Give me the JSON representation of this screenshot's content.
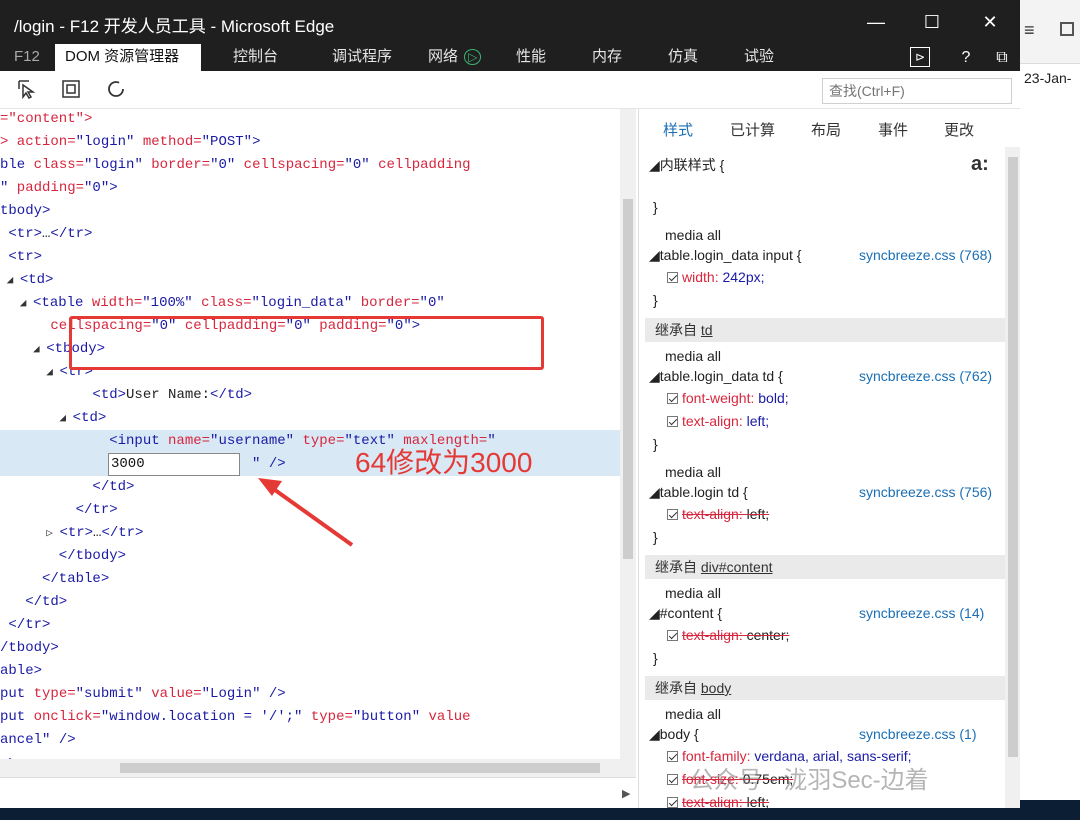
{
  "background": {
    "date_fragment": "23-Jan-"
  },
  "window": {
    "title": "/login - F12 开发人员工具 - Microsoft Edge",
    "minimize": "—",
    "maximize": "☐",
    "close": "✕"
  },
  "tabs": {
    "f12": "F12",
    "items": [
      "DOM 资源管理器",
      "控制台",
      "调试程序",
      "网络",
      "性能",
      "内存",
      "仿真",
      "试验"
    ],
    "network_icon": "▷",
    "tools": [
      "⊳",
      "?",
      "⧉"
    ]
  },
  "toolbar": {
    "find_placeholder": "查找(Ctrl+F)"
  },
  "dom": {
    "lines": [
      {
        "seg": [
          [
            "an",
            "=\"content\">"
          ]
        ]
      },
      {
        "seg": [
          [
            "an",
            "> action="
          ],
          [
            "av",
            "\"login\""
          ],
          [
            "an",
            " method="
          ],
          [
            "av",
            "\"POST\""
          ],
          [
            "tg",
            ">"
          ]
        ]
      },
      {
        "seg": [
          [
            "tg",
            "ble "
          ],
          [
            "an",
            "class="
          ],
          [
            "av",
            "\"login\""
          ],
          [
            "an",
            " border="
          ],
          [
            "av",
            "\"0\""
          ],
          [
            "an",
            " cellspacing="
          ],
          [
            "av",
            "\"0\""
          ],
          [
            "an",
            " cellpadding"
          ]
        ]
      },
      {
        "seg": [
          [
            "av",
            "\""
          ],
          [
            "an",
            " padding="
          ],
          [
            "av",
            "\"0\""
          ],
          [
            "tg",
            ">"
          ]
        ]
      },
      {
        "seg": [
          [
            "tg",
            "tbody>"
          ]
        ]
      },
      {
        "seg": [
          [
            "tg",
            " <tr>"
          ],
          [
            "tx",
            "…"
          ],
          [
            "tg",
            "</tr>"
          ]
        ]
      },
      {
        "seg": [
          [
            "tg",
            " <tr>"
          ]
        ]
      },
      {
        "seg": [
          [
            "arr",
            " ◢ "
          ],
          [
            "tg",
            "<td>"
          ]
        ]
      },
      {
        "seg": [
          [
            "arr",
            "   ◢ "
          ],
          [
            "tg",
            "<table "
          ],
          [
            "an",
            "width="
          ],
          [
            "av",
            "\"100%\""
          ],
          [
            "an",
            " class="
          ],
          [
            "av",
            "\"login_data\""
          ],
          [
            "an",
            " border="
          ],
          [
            "av",
            "\"0\""
          ]
        ]
      },
      {
        "seg": [
          [
            "an",
            "      cellspacing="
          ],
          [
            "av",
            "\"0\""
          ],
          [
            "an",
            " cellpadding="
          ],
          [
            "av",
            "\"0\""
          ],
          [
            "an",
            " padding="
          ],
          [
            "av",
            "\"0\""
          ],
          [
            "tg",
            ">"
          ]
        ]
      },
      {
        "seg": [
          [
            "arr",
            "     ◢ "
          ],
          [
            "tg",
            "<tbody>"
          ]
        ]
      },
      {
        "seg": [
          [
            "arr",
            "       ◢ "
          ],
          [
            "tg",
            "<tr>"
          ]
        ]
      },
      {
        "seg": [
          [
            "tg",
            "           <td>"
          ],
          [
            "tx",
            "User Name:"
          ],
          [
            "tg",
            "</td>"
          ]
        ]
      },
      {
        "seg": [
          [
            "arr",
            "         ◢ "
          ],
          [
            "tg",
            "<td>"
          ]
        ]
      },
      {
        "seg": [
          [
            "tg",
            "             <input "
          ],
          [
            "an",
            "name="
          ],
          [
            "av",
            "\"username\""
          ],
          [
            "an",
            " type="
          ],
          [
            "av",
            "\"text\""
          ],
          [
            "an",
            " maxlength="
          ],
          [
            "av",
            "\""
          ]
        ],
        "sel": true
      },
      {
        "seg": [
          [
            "av",
            "                              \""
          ],
          [
            "tg",
            " />"
          ]
        ],
        "sel": true
      },
      {
        "seg": [
          [
            "tg",
            "           </td>"
          ]
        ]
      },
      {
        "seg": [
          [
            "tg",
            "         </tr>"
          ]
        ]
      },
      {
        "seg": [
          [
            "arr",
            "       ▷ "
          ],
          [
            "tg",
            "<tr>"
          ],
          [
            "tx",
            "…"
          ],
          [
            "tg",
            "</tr>"
          ]
        ]
      },
      {
        "seg": [
          [
            "tg",
            "       </tbody>"
          ]
        ]
      },
      {
        "seg": [
          [
            "tg",
            "     </table>"
          ]
        ]
      },
      {
        "seg": [
          [
            "tg",
            "   </td>"
          ]
        ]
      },
      {
        "seg": [
          [
            "tg",
            " </tr>"
          ]
        ]
      },
      {
        "seg": [
          [
            "tg",
            "/tbody>"
          ]
        ]
      },
      {
        "seg": [
          [
            "tg",
            "able>"
          ]
        ]
      },
      {
        "seg": [
          [
            "tg",
            "put "
          ],
          [
            "an",
            "type="
          ],
          [
            "av",
            "\"submit\""
          ],
          [
            "an",
            " value="
          ],
          [
            "av",
            "\"Login\""
          ],
          [
            "tg",
            " />"
          ]
        ]
      },
      {
        "seg": [
          [
            "tg",
            "put "
          ],
          [
            "an",
            "onclick="
          ],
          [
            "av",
            "\"window.location = '/';\""
          ],
          [
            "an",
            " type="
          ],
          [
            "av",
            "\"button\""
          ],
          [
            "an",
            " value"
          ]
        ]
      },
      {
        "seg": [
          [
            "av",
            "ancel\""
          ],
          [
            "tg",
            " />"
          ]
        ]
      },
      {
        "seg": [
          [
            "tg",
            "->"
          ]
        ]
      }
    ],
    "edit_value": "3000",
    "annotation": "64修改为3000"
  },
  "styles": {
    "tabs": [
      "样式",
      "已计算",
      "布局",
      "事件",
      "更改"
    ],
    "new_rule_icon": "a:",
    "inline_header": "◢内联样式 {",
    "close_brace": "}",
    "rules": [
      {
        "media": "media all",
        "selector": "◢table.login_data input {",
        "source": "syncbreeze.css (768)",
        "props": [
          {
            "name": "width",
            "value": "242px;",
            "struck": false
          }
        ]
      },
      {
        "inherit": "继承自 ",
        "inherit_link": "td"
      },
      {
        "media": "media all",
        "selector": "◢table.login_data td {",
        "source": "syncbreeze.css (762)",
        "props": [
          {
            "name": "font-weight",
            "value": "bold;",
            "struck": false
          },
          {
            "name": "text-align",
            "value": "left;",
            "struck": false
          }
        ]
      },
      {
        "media": "media all",
        "selector": "◢table.login td {",
        "source": "syncbreeze.css (756)",
        "props": [
          {
            "name": "text-align",
            "value": "left;",
            "struck": true
          }
        ]
      },
      {
        "inherit": "继承自 ",
        "inherit_link": "div#content"
      },
      {
        "media": "media all",
        "selector": "◢#content {",
        "source": "syncbreeze.css (14)",
        "props": [
          {
            "name": "text-align",
            "value": "center;",
            "struck": true
          }
        ]
      },
      {
        "inherit": "继承自 ",
        "inherit_link": "body"
      },
      {
        "media": "media all",
        "selector": "◢body {",
        "source": "syncbreeze.css (1)",
        "props": [
          {
            "name": "font-family",
            "value": "verdana, arial, sans-serif;",
            "struck": false
          },
          {
            "name": "font-size",
            "value": "0.75em;",
            "struck": true
          },
          {
            "name": "text-align",
            "value": "left;",
            "struck": true
          }
        ]
      }
    ]
  },
  "watermark": "公众号 · 泷羽Sec-边着",
  "colors": {
    "highlight": "#e53935",
    "link": "#1a6fb5",
    "attr_name": "#d7263d",
    "attr_value": "#1a1aa6"
  }
}
